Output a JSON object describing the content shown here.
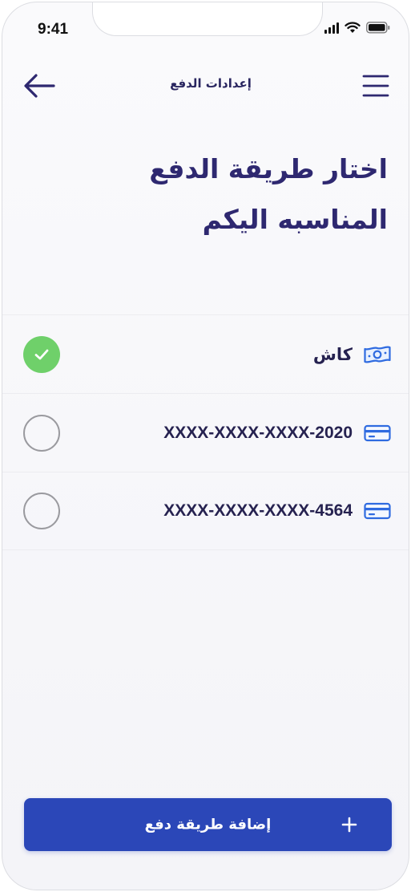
{
  "status_bar": {
    "time": "9:41"
  },
  "header": {
    "title": "إعدادات الدفع"
  },
  "page": {
    "title": "اختار طريقة الدفع المناسبه اليكم"
  },
  "payment_methods": [
    {
      "label": "كاش",
      "icon": "cash-icon",
      "selected": true
    },
    {
      "label": "XXXX-XXXX-XXXX-2020",
      "icon": "credit-card-icon",
      "selected": false
    },
    {
      "label": "XXXX-XXXX-XXXX-4564",
      "icon": "credit-card-icon",
      "selected": false
    }
  ],
  "add_button": {
    "label": "إضافة طريقة دفع"
  },
  "colors": {
    "primary": "#2b47b8",
    "title_text": "#2e2870",
    "icon_blue": "#2f6be0",
    "selected_green": "#6fd06a",
    "radio_border": "#9a9a9f"
  }
}
